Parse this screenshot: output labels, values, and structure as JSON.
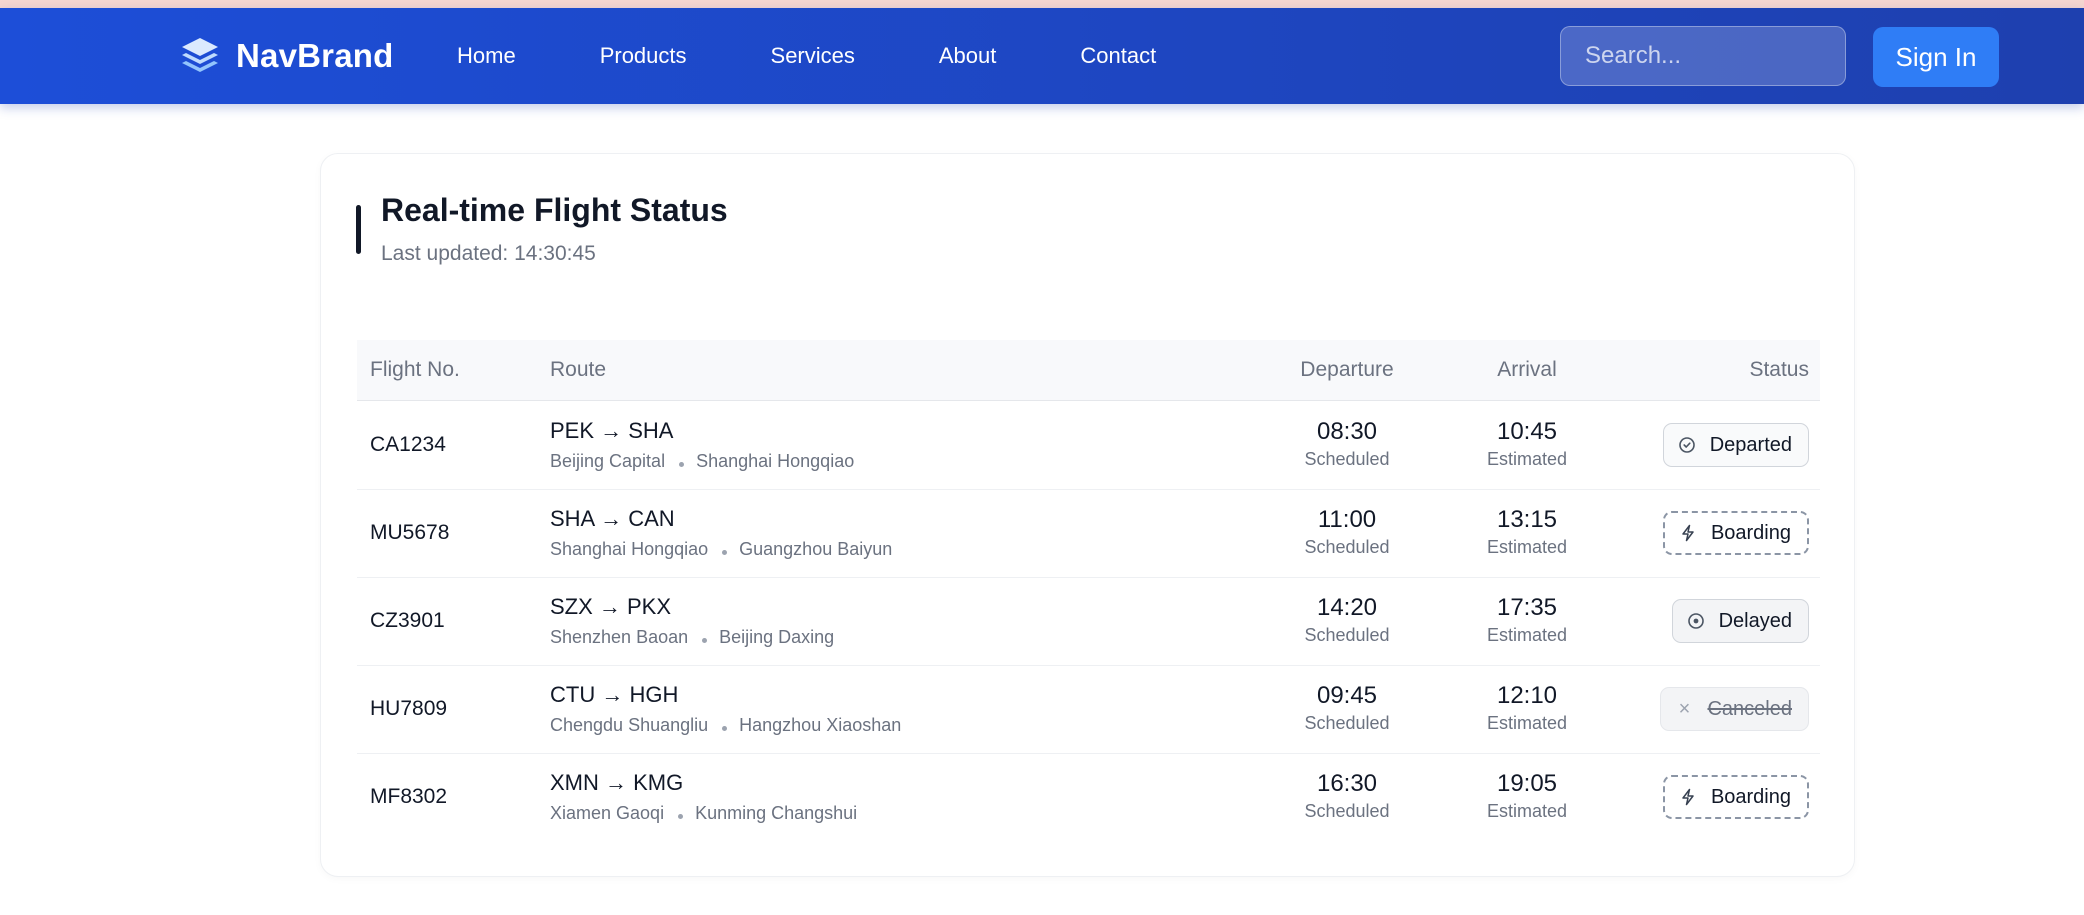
{
  "nav": {
    "brand": "NavBrand",
    "links": [
      "Home",
      "Products",
      "Services",
      "About",
      "Contact"
    ],
    "search_placeholder": "Search...",
    "signin_label": "Sign In"
  },
  "panel": {
    "title": "Real-time Flight Status",
    "updated": "Last updated: 14:30:45"
  },
  "table": {
    "headers": [
      "Flight No.",
      "Route",
      "Departure",
      "Arrival",
      "Status"
    ],
    "rows": [
      {
        "flight": "CA1234",
        "route": "PEK → SHA",
        "from": "Beijing Capital",
        "to": "Shanghai Hongqiao",
        "dep": "08:30",
        "dep_label": "Scheduled",
        "arr": "10:45",
        "arr_label": "Estimated",
        "status": "Departed",
        "status_icon": "clock-circle-icon"
      },
      {
        "flight": "MU5678",
        "route": "SHA → CAN",
        "from": "Shanghai Hongqiao",
        "to": "Guangzhou Baiyun",
        "dep": "11:00",
        "dep_label": "Scheduled",
        "arr": "13:15",
        "arr_label": "Estimated",
        "status": "Boarding",
        "status_icon": "lightning-icon"
      },
      {
        "flight": "CZ3901",
        "route": "SZX → PKX",
        "from": "Shenzhen Baoan",
        "to": "Beijing Daxing",
        "dep": "14:20",
        "dep_label": "Scheduled",
        "arr": "17:35",
        "arr_label": "Estimated",
        "status": "Delayed",
        "status_icon": "target-circle-icon"
      },
      {
        "flight": "HU7809",
        "route": "CTU → HGH",
        "from": "Chengdu Shuangliu",
        "to": "Hangzhou Xiaoshan",
        "dep": "09:45",
        "dep_label": "Scheduled",
        "arr": "12:10",
        "arr_label": "Estimated",
        "status": "Canceled",
        "status_icon": "close-icon"
      },
      {
        "flight": "MF8302",
        "route": "XMN → KMG",
        "from": "Xiamen Gaoqi",
        "to": "Kunming Changshui",
        "dep": "16:30",
        "dep_label": "Scheduled",
        "arr": "19:05",
        "arr_label": "Estimated",
        "status": "Boarding",
        "status_icon": "lightning-icon"
      }
    ]
  },
  "colors": {
    "nav_start": "#1d4ed8",
    "nav_end": "#1e40af",
    "signin": "#2f7df6"
  }
}
